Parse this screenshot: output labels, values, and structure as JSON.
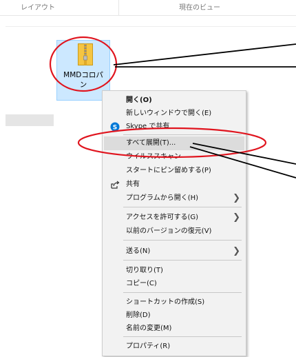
{
  "header": {
    "col1_label": "レイアウト",
    "col2_label": "現在のビュー"
  },
  "file": {
    "name": "MMDコロパン",
    "icon": "zip-folder-icon"
  },
  "context_menu": {
    "items": [
      {
        "id": "open",
        "label": "開く(O)",
        "bold": true
      },
      {
        "id": "open-new-window",
        "label": "新しいウィンドウで開く(E)"
      },
      {
        "id": "skype",
        "label": "Skype で共有",
        "icon": "skype-icon"
      },
      {
        "id": "extract-all",
        "label": "すべて展開(T)...",
        "highlighted": true
      },
      {
        "id": "virus-scan",
        "label": "ウイルススキャン"
      },
      {
        "id": "pin-start",
        "label": "スタートにピン留めする(P)"
      },
      {
        "id": "share",
        "label": "共有",
        "icon": "share-icon"
      },
      {
        "id": "open-with",
        "label": "プログラムから開く(H)",
        "submenu": true
      },
      {
        "id": "give-access",
        "label": "アクセスを許可する(G)",
        "submenu": true
      },
      {
        "id": "restore-versions",
        "label": "以前のバージョンの復元(V)"
      },
      {
        "id": "send-to",
        "label": "送る(N)",
        "submenu": true
      },
      {
        "id": "cut",
        "label": "切り取り(T)"
      },
      {
        "id": "copy",
        "label": "コピー(C)"
      },
      {
        "id": "create-shortcut",
        "label": "ショートカットの作成(S)"
      },
      {
        "id": "delete",
        "label": "削除(D)"
      },
      {
        "id": "rename",
        "label": "名前の変更(M)"
      },
      {
        "id": "properties",
        "label": "プロパティ(R)"
      }
    ]
  },
  "colors": {
    "annotation_red": "#e0141e",
    "selection_blue": "#cce8ff",
    "menu_background": "#f2f2f2",
    "skype_blue": "#0078d7"
  }
}
